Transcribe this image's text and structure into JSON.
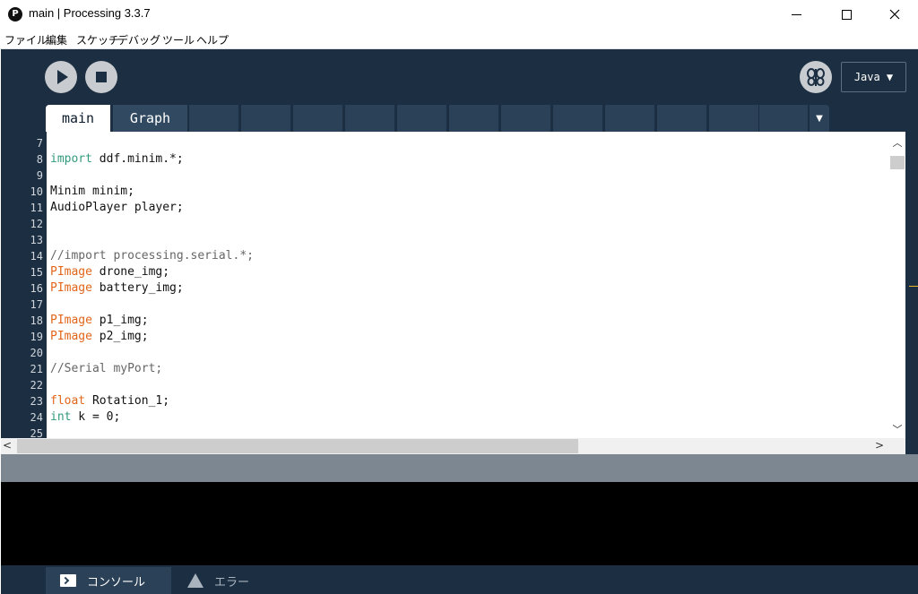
{
  "window": {
    "title": "main | Processing 3.3.7",
    "icon_letter": "P"
  },
  "menu": [
    "ファイル",
    "編集",
    "スケッチ",
    "デバッグ",
    "ツール",
    "ヘルプ"
  ],
  "toolbar": {
    "mode_label": "Java ▼"
  },
  "tabs": [
    {
      "label": "main",
      "active": true
    },
    {
      "label": "Graph",
      "active": false
    }
  ],
  "editor": {
    "lines": [
      {
        "num": "7",
        "text": ""
      },
      {
        "num": "8",
        "kw": "import",
        "rest": " ddf.minim.*;",
        "kwclass": "blue"
      },
      {
        "num": "9",
        "text": ""
      },
      {
        "num": "10",
        "text": "Minim minim;"
      },
      {
        "num": "11",
        "text": "AudioPlayer player;"
      },
      {
        "num": "12",
        "text": ""
      },
      {
        "num": "13",
        "text": ""
      },
      {
        "num": "14",
        "comment": "//import processing.serial.*;"
      },
      {
        "num": "15",
        "kw": "PImage",
        "rest": " drone_img;",
        "kwclass": "orange"
      },
      {
        "num": "16",
        "kw": "PImage",
        "rest": " battery_img;",
        "kwclass": "orange"
      },
      {
        "num": "17",
        "text": ""
      },
      {
        "num": "18",
        "kw": "PImage",
        "rest": " p1_img;",
        "kwclass": "orange"
      },
      {
        "num": "19",
        "kw": "PImage",
        "rest": " p2_img;",
        "kwclass": "orange"
      },
      {
        "num": "20",
        "text": ""
      },
      {
        "num": "21",
        "comment": "//Serial myPort;"
      },
      {
        "num": "22",
        "text": ""
      },
      {
        "num": "23",
        "kw": "float",
        "rest": " Rotation_1;",
        "kwclass": "orange"
      },
      {
        "num": "24",
        "kw": "int",
        "rest": " k = 0;",
        "kwclass": "blue"
      },
      {
        "num": "25",
        "text": ""
      }
    ]
  },
  "footer": {
    "console_label": "コンソール",
    "errors_label": "エラー"
  }
}
